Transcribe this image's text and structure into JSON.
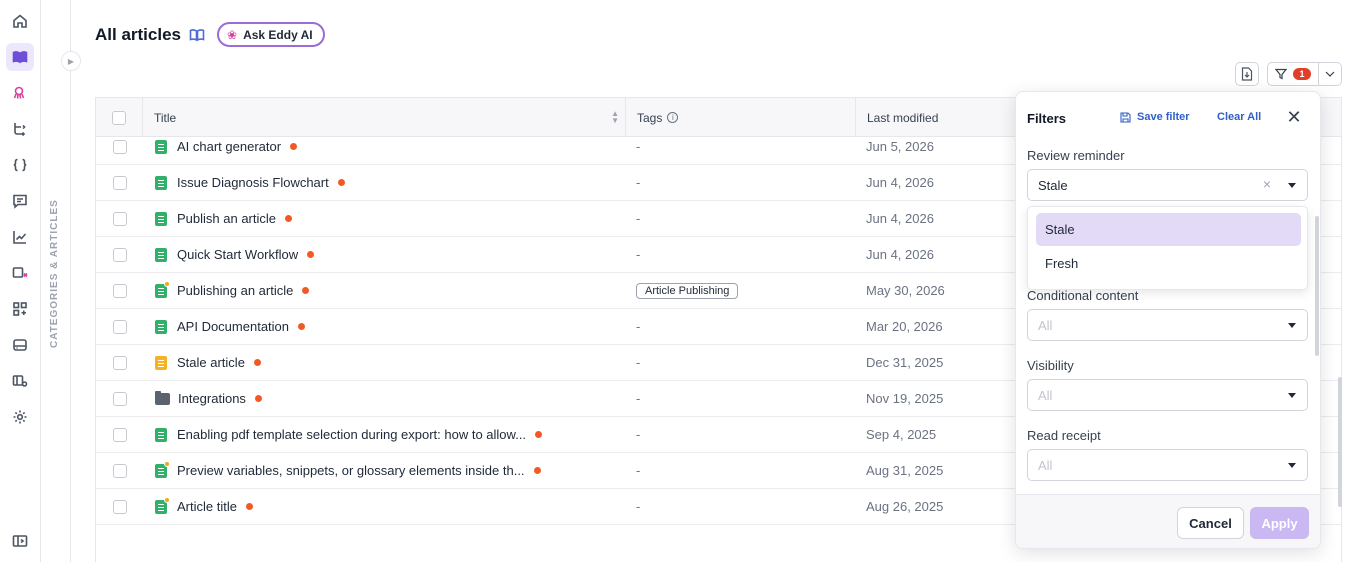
{
  "page": {
    "title": "All articles",
    "ask_eddy_label": "Ask Eddy AI",
    "category_pane_label": "CATEGORIES & ARTICLES"
  },
  "filter_badge": "1",
  "table": {
    "headers": {
      "title": "Title",
      "tags": "Tags",
      "last_modified": "Last modified"
    },
    "rows": [
      {
        "title": "AI chart generator",
        "tags": "-",
        "modified": "Jun 5, 2026",
        "icon": "green",
        "marked": false
      },
      {
        "title": "Issue Diagnosis Flowchart",
        "tags": "-",
        "modified": "Jun 4, 2026",
        "icon": "green",
        "marked": false
      },
      {
        "title": "Publish an article",
        "tags": "-",
        "modified": "Jun 4, 2026",
        "icon": "green",
        "marked": false
      },
      {
        "title": "Quick Start Workflow",
        "tags": "-",
        "modified": "Jun 4, 2026",
        "icon": "green",
        "marked": false
      },
      {
        "title": "Publishing an article",
        "tags": "Article Publishing",
        "modified": "May 30, 2026",
        "icon": "green",
        "marked": true
      },
      {
        "title": "API Documentation",
        "tags": "-",
        "modified": "Mar 20, 2026",
        "icon": "green",
        "marked": false
      },
      {
        "title": "Stale article",
        "tags": "-",
        "modified": "Dec 31, 2025",
        "icon": "amber",
        "marked": false
      },
      {
        "title": "Integrations",
        "tags": "-",
        "modified": "Nov 19, 2025",
        "icon": "folder",
        "marked": false
      },
      {
        "title": "Enabling pdf template selection during export: how to allow...",
        "tags": "-",
        "modified": "Sep 4, 2025",
        "icon": "green",
        "marked": false
      },
      {
        "title": "Preview variables, snippets, or glossary elements inside th...",
        "tags": "-",
        "modified": "Aug 31, 2025",
        "icon": "green",
        "marked": true
      },
      {
        "title": "Article title",
        "tags": "-",
        "modified": "Aug 26, 2025",
        "icon": "green",
        "marked": true
      }
    ]
  },
  "filters": {
    "title": "Filters",
    "save_filter": "Save filter",
    "clear_all": "Clear All",
    "review_reminder": {
      "label": "Review reminder",
      "value": "Stale",
      "options": [
        "Stale",
        "Fresh"
      ]
    },
    "conditional_content": {
      "label": "Conditional content",
      "placeholder": "All"
    },
    "visibility": {
      "label": "Visibility",
      "placeholder": "All"
    },
    "read_receipt": {
      "label": "Read receipt",
      "placeholder": "All"
    },
    "cancel": "Cancel",
    "apply": "Apply"
  },
  "colors": {
    "accent": "#6d4fd8",
    "link": "#2f5fc7",
    "status_dot": "#f15a24",
    "badge": "#e23d28"
  }
}
